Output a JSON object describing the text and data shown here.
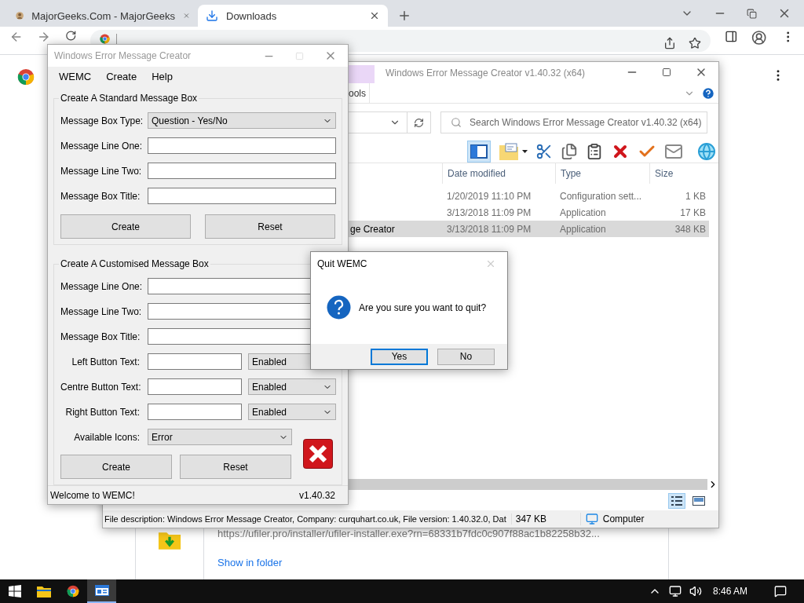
{
  "browser": {
    "tabs": [
      {
        "title": "MajorGeeks.Com - MajorGeeks",
        "selected": false
      },
      {
        "title": "Downloads",
        "selected": true
      }
    ],
    "download": {
      "url": "https://ufiler.pro/installer/ufiler-installer.exe?rn=68331b7fdc0c907f88ac1b82258b32...",
      "link": "Show in folder"
    }
  },
  "explorer": {
    "title": "Windows Error Message Creator v1.40.32 (x64)",
    "ribbon_tab": "ools",
    "search": {
      "placeholder": "Search Windows Error Message Creator v1.40.32 (x64)"
    },
    "columns": [
      "Date modified",
      "Type",
      "Size"
    ],
    "rows": [
      {
        "date": "1/20/2019 11:10 PM",
        "type": "Configuration sett...",
        "size": "1 KB",
        "selected": false
      },
      {
        "date": "3/13/2018 11:09 PM",
        "type": "Application",
        "size": "17 KB",
        "selected": false
      },
      {
        "name": "ge Creator",
        "date": "3/13/2018 11:09 PM",
        "type": "Application",
        "size": "348 KB",
        "selected": true
      }
    ],
    "status_bar": {
      "description": "File description: Windows Error Message Creator, Company: curquhart.co.uk, File version: 1.40.32.0, Dat",
      "size": "347 KB",
      "location": "Computer"
    }
  },
  "wemc": {
    "title": "Windows Error Message Creator",
    "menu": [
      "WEMC",
      "Create",
      "Help"
    ],
    "standard": {
      "title": "Create A Standard Message Box",
      "fields": [
        {
          "kind": "select",
          "label": "Message Box Type:",
          "value": "Question - Yes/No"
        },
        {
          "kind": "text",
          "label": "Message Line One:"
        },
        {
          "kind": "text",
          "label": "Message Line Two:"
        },
        {
          "kind": "text",
          "label": "Message Box Title:"
        }
      ],
      "buttons": [
        "Create",
        "Reset"
      ]
    },
    "custom": {
      "title": "Create A Customised Message Box",
      "fields": [
        {
          "kind": "text",
          "label": "Message Line One:"
        },
        {
          "kind": "text",
          "label": "Message Line Two:"
        },
        {
          "kind": "text",
          "label": "Message Box Title:"
        },
        {
          "kind": "text_select",
          "label": "Left Button Text:",
          "option": "Enabled"
        },
        {
          "kind": "text_select",
          "label": "Centre Button Text:",
          "option": "Enabled"
        },
        {
          "kind": "text_select",
          "label": "Right Button Text:",
          "option": "Enabled"
        }
      ],
      "icon_field": {
        "label": "Available Icons:",
        "value": "Error"
      },
      "buttons": [
        "Create",
        "Reset"
      ]
    },
    "status_bar": {
      "message": "Welcome to WEMC!",
      "version": "v1.40.32"
    }
  },
  "dialog": {
    "title": "Quit WEMC",
    "message": "Are you sure you want to quit?",
    "buttons": [
      {
        "label": "Yes",
        "selected": true
      },
      {
        "label": "No",
        "selected": false
      }
    ]
  },
  "taskbar": {
    "time": "8:46 AM"
  }
}
